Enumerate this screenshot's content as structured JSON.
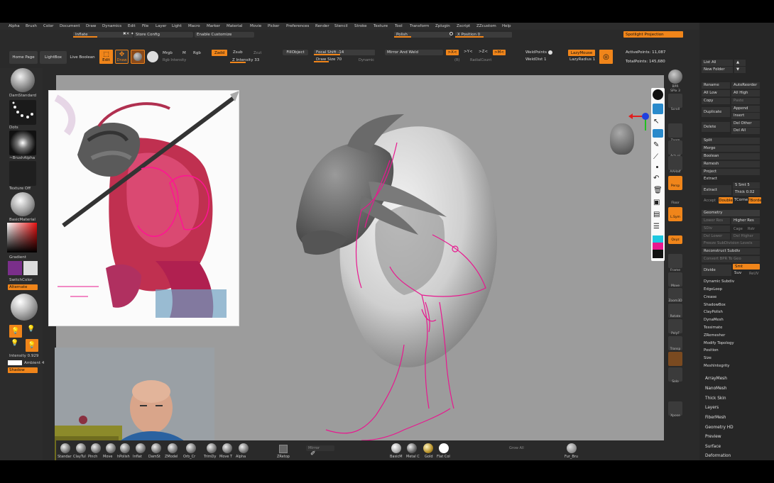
{
  "menu": [
    "Alpha",
    "Brush",
    "Color",
    "Document",
    "Draw",
    "Dynamics",
    "Edit",
    "File",
    "Layer",
    "Light",
    "Macro",
    "Marker",
    "Material",
    "Movie",
    "Picker",
    "Preferences",
    "Render",
    "Stencil",
    "Stroke",
    "Texture",
    "Tool",
    "Transform",
    "Zplugin",
    "Zscript",
    "ZZcustom",
    "Help"
  ],
  "subbar": {
    "inflate": "Inflate",
    "store_config": "Store Config",
    "enable_customize": "Enable Customize",
    "polish": "Polish",
    "x_position": "X Position 0",
    "spotlight_projection": "Spotlight Projection",
    "symmetry": "✖✕ ✦"
  },
  "toolbar": {
    "home_page": "Home Page",
    "lightbox": "LightBox",
    "live_boolean": "Live Boolean",
    "edit": "Edit",
    "draw": "Draw",
    "mrgb": "Mrgb",
    "rgb": "Rgb",
    "m": "M",
    "rgb_intensity": "Rgb Intensity",
    "zadd": "Zadd",
    "zsub": "Zsub",
    "zcut": "Zcut",
    "z_intensity": "Z Intensity 33",
    "fill_object": "FillObject",
    "focal_shift": "Focal Shift -14",
    "draw_size": "Draw Size 70",
    "dynamic": "Dynamic",
    "mirror_and_weld": "Mirror And Weld",
    "mx": ">X<",
    "my": ">Y<",
    "mz": ">Z<",
    "mm": ">M<",
    "radial_count": "RadialCount",
    "r": "(R)",
    "weld_points": "WeldPoints",
    "weld_dist": "WeldDist 1",
    "lazy_mouse": "LazyMouse",
    "lazy_radius": "LazyRadius 1",
    "active_points": "ActivePoints: 11,087",
    "total_points": "TotalPoints: 145,680"
  },
  "left_shelf": {
    "brush": "DamStandard",
    "stroke": "Dots",
    "alpha": "~BrushAlpha",
    "texture": "Texture Off",
    "material": "BasicMaterial",
    "gradient": "Gradient",
    "switch_color": "SwitchColor",
    "alternate": "Alternate",
    "intensity": "Intensity 0.929",
    "ambient": "Ambient 4",
    "shadow": "Shadow"
  },
  "right_tray": {
    "list_all": "List All",
    "new_folder": "New Folder",
    "rename": "Rename",
    "auto_reorder": "AutoReorder",
    "all_low": "All Low",
    "all_high": "All High",
    "copy": "Copy",
    "paste": "Paste",
    "duplicate": "Duplicate",
    "append": "Append",
    "insert": "Insert",
    "delete": "Delete",
    "del_other": "Del Other",
    "del_all": "Del All",
    "split": "Split",
    "merge": "Merge",
    "boolean": "Boolean",
    "remesh": "Remesh",
    "project": "Project",
    "extract_hdr": "Extract",
    "extract": "Extract",
    "s_smt": "S Smt 5",
    "thick": "Thick 0.02",
    "accept": "Accept",
    "double": "Double",
    "tcorne": "TCorne",
    "tborde": "TBorde",
    "geometry": "Geometry",
    "lower_res": "Lower Res",
    "higher_res": "Higher Res",
    "sdiv": "SDiv",
    "cage": "Cage",
    "rstr": "Rstr",
    "del_lower": "Del Lower",
    "del_higher": "Del Higher",
    "freeze_subdiv": "Freeze SubDivision Levels",
    "reconstruct_subdiv": "Reconstruct Subdiv",
    "convert_bpr": "Convert BPR To Geo",
    "divide": "Divide",
    "smt": "Smt",
    "suv": "Suv",
    "reuv": "ReUV",
    "dynamic_subdiv": "Dynamic Subdiv",
    "edgeloop": "EdgeLoop",
    "crease": "Crease",
    "shadowbox": "ShadowBox",
    "claypolish": "ClayPolish",
    "dynamesh": "DynaMesh",
    "tessimate": "Tessimate",
    "zremesher": "ZRemesher",
    "modify_topology": "Modify Topology",
    "position": "Position",
    "size": "Size",
    "meshintegrity": "MeshIntegrity",
    "arraymesh": "ArrayMesh",
    "nanomesh": "NanoMesh",
    "thick_skin": "Thick Skin",
    "layers": "Layers",
    "fibermesh": "FiberMesh",
    "geometry_hd": "Geometry HD",
    "preview": "Preview",
    "surface": "Surface",
    "deformation": "Deformation"
  },
  "view_tools": {
    "bpr": "BPR",
    "spix": "SPix 3",
    "scroll": "Scroll",
    "zoom": "Zoom",
    "actual": "Actual",
    "aahalf": "AAHalf",
    "persp": "Persp",
    "floor": "Floor",
    "lsym": "L.Sym",
    "qxyz": "Qxyz",
    "frame": "Frame",
    "move": "Move",
    "zoom3d": "Zoom3D",
    "rotate": "Rotate",
    "polyf": "PolyF",
    "transp": "Transp",
    "solo": "Solo",
    "xpose": "Xpose"
  },
  "bottom_shelf": {
    "brushes": [
      "Standar",
      "ClayTul",
      "Pinch",
      "Move",
      "hPolish",
      "Inflat",
      "DamSt",
      "ZModel",
      "Orb_Cr",
      "TrimDy",
      "Move T",
      "Alpha"
    ],
    "zretop": "ZRetop",
    "mirror": "Mirror",
    "grow_all": "Grow All",
    "materials": [
      "BasicM",
      "Metal C",
      "Gold",
      "Flat Col"
    ],
    "fur": "Fur_Bru"
  },
  "colors": {
    "accent": "#f0851a",
    "stroke_magenta": "#e8188f",
    "viewport_bg": "#9c9c9c"
  }
}
